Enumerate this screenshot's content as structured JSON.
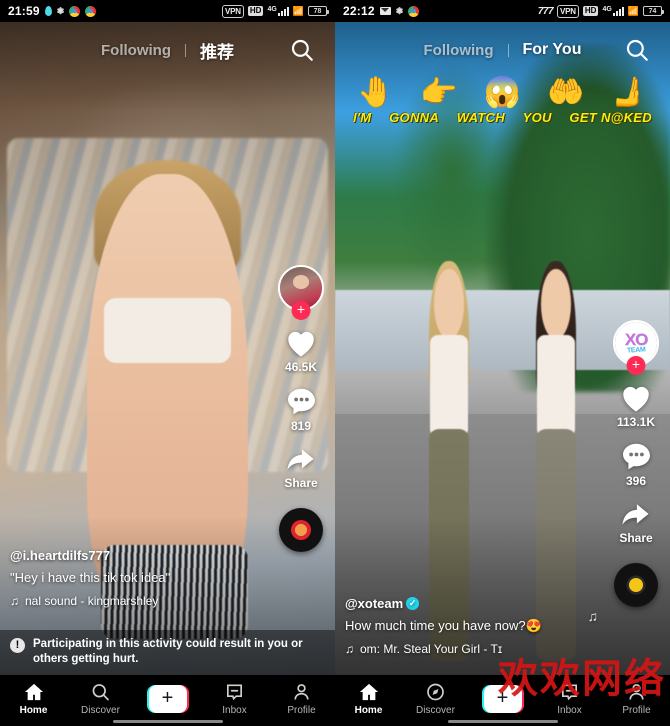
{
  "left_phone": {
    "statusbar": {
      "time": "21:59",
      "left_icons": [
        "water-drop-icon",
        "weather-icon",
        "chrome-icon",
        "photos-icon"
      ],
      "vpn": "VPN",
      "hd": "HD",
      "network": "4G",
      "battery": "78"
    },
    "topnav": {
      "following": "Following",
      "foryou": "推荐",
      "active": "foryou",
      "search_icon": "search-icon"
    },
    "rail": {
      "avatar_name": "creator-avatar",
      "follow_label": "+",
      "like_count": "46.5K",
      "comment_count": "819",
      "share_label": "Share",
      "disc_name": "music-disc"
    },
    "caption": {
      "username": "@i.heartdilfs777",
      "verified": false,
      "text": "\"Hey i have this tik tok idea\"",
      "music": "nal sound - kingmarshley"
    },
    "warning": {
      "icon": "!",
      "text": "Participating in this activity could result in you or others getting hurt."
    },
    "navbar": [
      {
        "label": "Home",
        "icon": "home-icon",
        "active": true
      },
      {
        "label": "Discover",
        "icon": "search-icon",
        "active": false
      },
      {
        "label": "",
        "icon": "create-plus-icon",
        "active": false
      },
      {
        "label": "Inbox",
        "icon": "inbox-icon",
        "active": false
      },
      {
        "label": "Profile",
        "icon": "person-icon",
        "active": false
      }
    ]
  },
  "right_phone": {
    "statusbar": {
      "time": "22:12",
      "left_icons": [
        "envelope-icon",
        "weather-icon",
        "photos-icon"
      ],
      "carrier": "777",
      "vpn": "VPN",
      "hd": "HD",
      "network": "4G",
      "battery": "74"
    },
    "topnav": {
      "following": "Following",
      "foryou": "For You",
      "active": "foryou",
      "search_icon": "search-icon"
    },
    "sticker": {
      "hands": [
        "🤚",
        "👉",
        "😱",
        "🤲",
        "🫸"
      ],
      "words": [
        "I'M",
        "GONNA",
        "WATCH",
        "YOU",
        "GET N@KED"
      ],
      "text_color": "#f5ef17"
    },
    "rail": {
      "avatar_name": "xo-team-avatar",
      "avatar_text": "XO",
      "avatar_sub": "TEAM",
      "follow_label": "+",
      "like_count": "113.1K",
      "comment_count": "396",
      "share_label": "Share",
      "disc_name": "music-disc"
    },
    "caption": {
      "username": "@xoteam",
      "verified": true,
      "verified_mark": "✓",
      "text": "How much time you have now?😍",
      "music": "om: Mr. Steal Your Girl - Tɪ"
    },
    "navbar": [
      {
        "label": "Home",
        "icon": "home-icon",
        "active": true
      },
      {
        "label": "Discover",
        "icon": "compass-icon",
        "active": false
      },
      {
        "label": "",
        "icon": "create-plus-icon",
        "active": false
      },
      {
        "label": "Inbox",
        "icon": "inbox-icon",
        "active": false
      },
      {
        "label": "Profile",
        "icon": "person-icon",
        "active": false
      }
    ]
  },
  "watermark": {
    "text": "欢欢网络",
    "color": "#d61414"
  }
}
